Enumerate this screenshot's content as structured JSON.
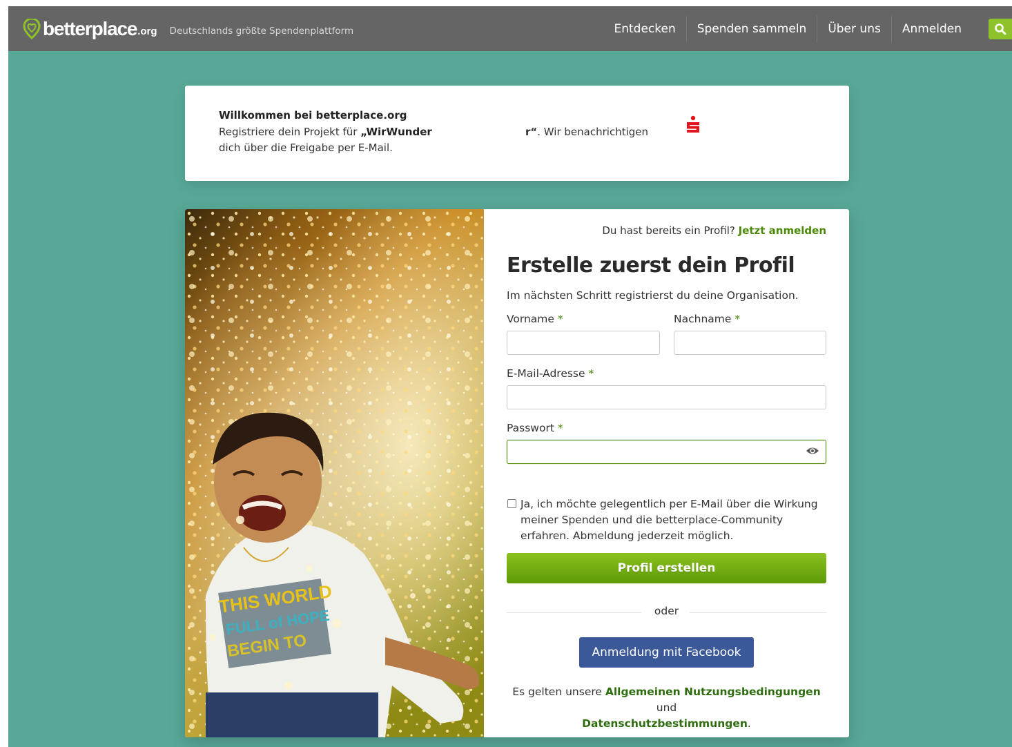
{
  "header": {
    "logo_word": "betterplace",
    "logo_tld": ".org",
    "tagline": "Deutschlands größte Spendenplattform",
    "nav": [
      "Entdecken",
      "Spenden sammeln",
      "Über uns",
      "Anmelden"
    ],
    "accent_color": "#8dc22a",
    "bar_color": "#656565"
  },
  "welcome": {
    "title": "Willkommen bei betterplace.org",
    "line1_prefix": "Registriere dein Projekt für ",
    "line1_bold": "„WirWunder",
    "line1_end_bold": "r“",
    "line1_end": ". Wir benachrichtigen",
    "line2": "dich über die Freigabe per E-Mail.",
    "partner_icon": "sparkasse-icon"
  },
  "form": {
    "login_hint_prefix": "Du hast bereits ein Profil? ",
    "login_link": "Jetzt anmelden",
    "title": "Erstelle zuerst dein Profil",
    "subtitle": "Im nächsten Schritt registrierst du deine Organisation.",
    "firstname_label": "Vorname",
    "lastname_label": "Nachname",
    "email_label": "E-Mail-Adresse",
    "password_label": "Passwort",
    "required_mark": "*",
    "firstname_value": "",
    "lastname_value": "",
    "email_value": "",
    "password_value": "",
    "newsletter_text": "Ja, ich möchte gelegentlich per E-Mail über die Wirkung meiner Spenden und die betterplace-Community erfahren. Abmeldung jederzeit möglich.",
    "newsletter_checked": false,
    "submit_label": "Profil erstellen",
    "divider_text": "oder",
    "facebook_label": "Anmeldung mit Facebook",
    "terms_prefix": "Es gelten unsere ",
    "terms_link": "Allgemeinen Nutzungsbedingungen",
    "terms_and": " und",
    "privacy_link": "Datenschutzbestimmungen",
    "terms_suffix": ".",
    "link_color": "#4b8a08",
    "facebook_color": "#3b5998"
  }
}
